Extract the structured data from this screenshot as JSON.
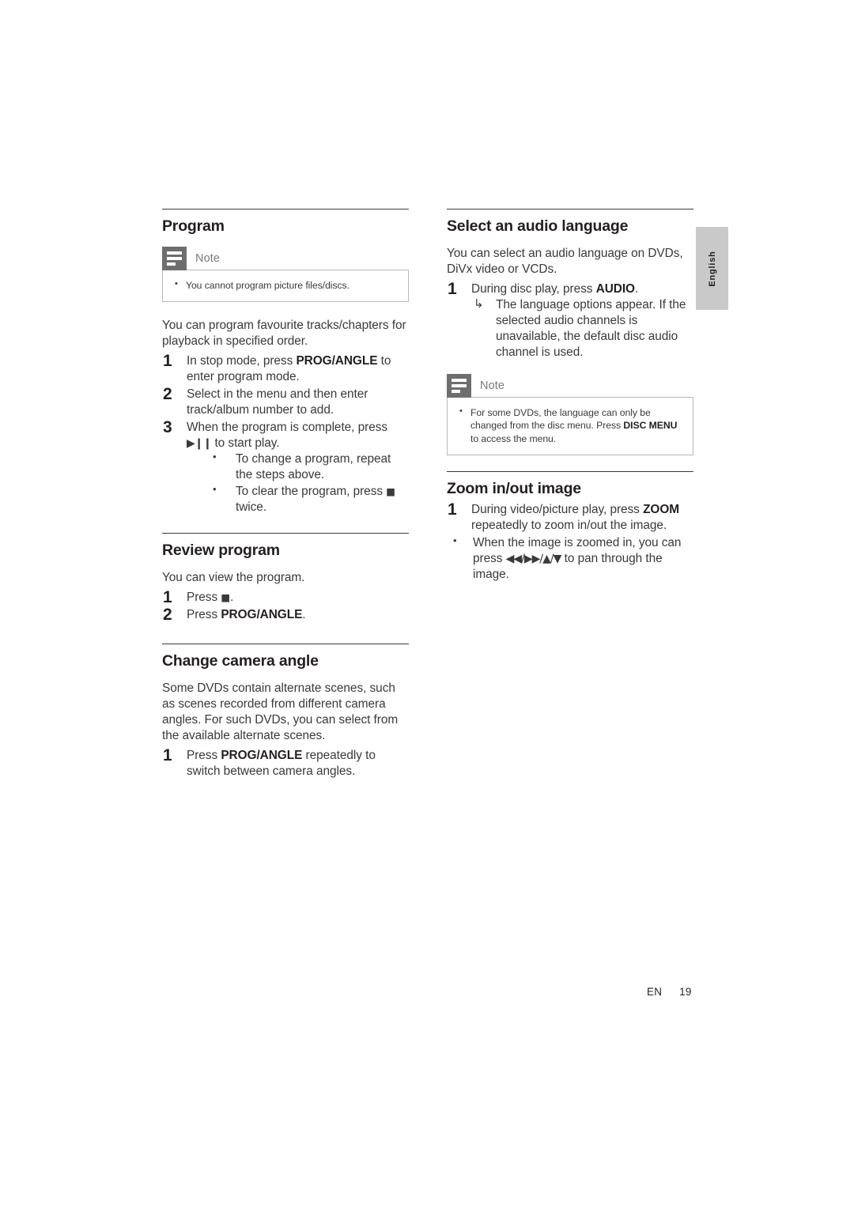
{
  "page": {
    "language_tab": "English",
    "footer_locale": "EN",
    "footer_page": "19"
  },
  "note_label": "Note",
  "left_column": {
    "program": {
      "heading": "Program",
      "note": "You cannot program picture files/discs.",
      "intro": "You can program favourite tracks/chapters for playback in specified order.",
      "steps": [
        "In stop mode, press PROG/ANGLE to enter program mode.",
        "Select in the menu and then enter track/album number to add.",
        "When the program is complete, press ▶❙❙ to start play."
      ],
      "step1_pre": "In stop mode, press ",
      "step1_kbd": "PROG/ANGLE",
      "step1_post": " to enter program mode.",
      "step2_text": "Select in the menu and then enter track/album number to add.",
      "step3_pre": "When the program is complete, press ",
      "step3_glyph": "▶❙❙",
      "step3_post": " to start play.",
      "sub_bullets": [
        "To change a program, repeat the steps above.",
        "To clear the program, press ■ twice."
      ],
      "bullet1_text": "To change a program, repeat the steps above.",
      "bullet2_pre": "To clear the program, press ",
      "bullet2_glyph": "■",
      "bullet2_post": " twice."
    },
    "review_program": {
      "heading": "Review program",
      "intro": "You can view the program.",
      "step1_pre": "Press ",
      "step1_glyph": "■",
      "step1_post": ".",
      "step2_pre": "Press ",
      "step2_kbd": "PROG/ANGLE",
      "step2_post": "."
    },
    "change_camera_angle": {
      "heading": "Change camera angle",
      "intro": "Some DVDs contain alternate scenes, such as scenes recorded from different camera angles. For such DVDs, you can select from the available alternate scenes.",
      "step1_pre": "Press ",
      "step1_kbd": "PROG/ANGLE",
      "step1_post": " repeatedly to switch between camera angles."
    }
  },
  "right_column": {
    "audio_language": {
      "heading": "Select an audio language",
      "intro": "You can select an audio language on DVDs, DiVx video or VCDs.",
      "step1_pre": "During disc play, press ",
      "step1_kbd": "AUDIO",
      "step1_post": ".",
      "step1_result": "The language options appear. If the selected audio channels is unavailable, the default disc audio channel is used.",
      "note_pre": "For some DVDs, the language can only be changed from the disc menu. Press ",
      "note_kbd": "DISC MENU",
      "note_post": " to access the menu."
    },
    "zoom_image": {
      "heading": "Zoom in/out image",
      "step1_pre": "During video/picture play, press ",
      "step1_kbd": "ZOOM",
      "step1_post": " repeatedly to zoom in/out the image.",
      "bullet_pre": "When the image is zoomed in, you can press ",
      "bullet_glyph": "◀◀/▶▶/▲/▼",
      "bullet_post": " to pan through the image."
    }
  },
  "colors": {
    "note_icon_bg": "#6e6e6e",
    "note_border": "#b9b9b9",
    "lang_tab_bg": "#c9c9c9",
    "rule": "#3b3b3b",
    "text": "#3a3a3a",
    "heading": "#231f20"
  }
}
